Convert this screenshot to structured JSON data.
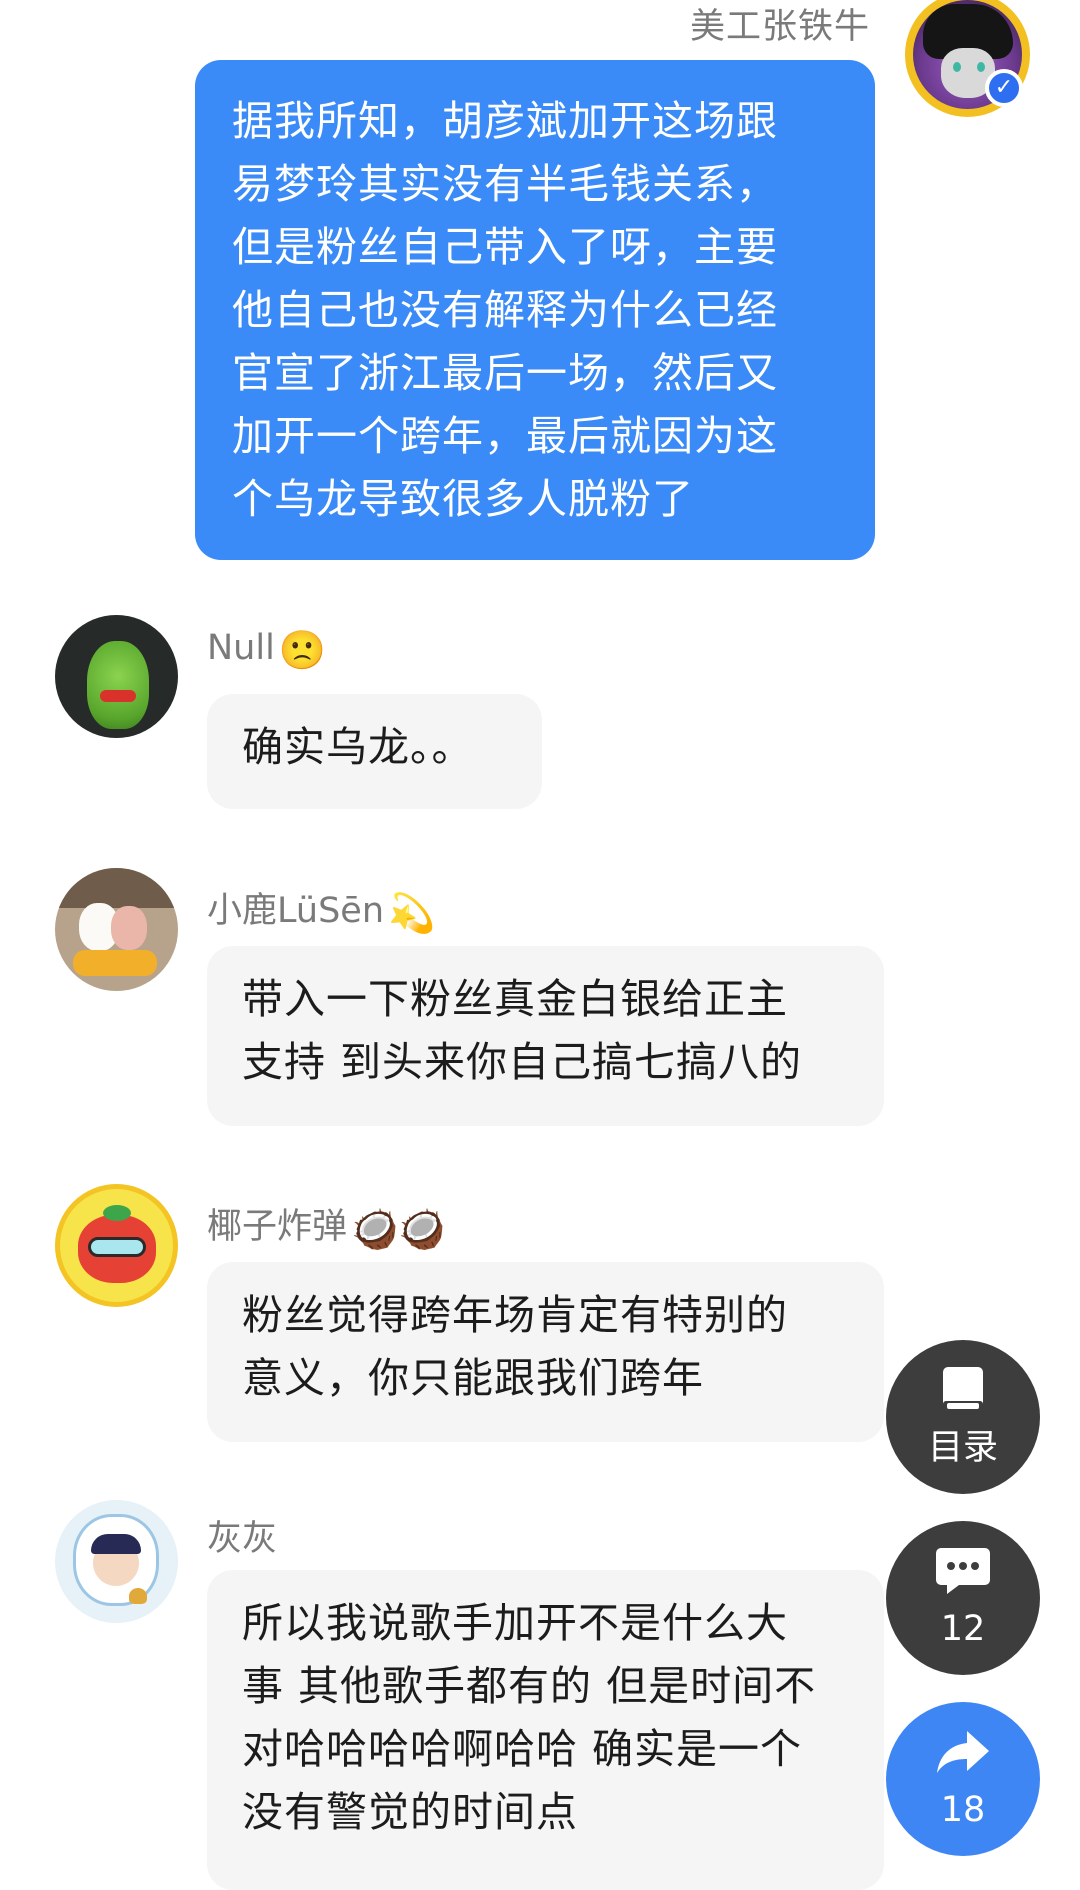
{
  "outgoing": {
    "sender": "美工张铁牛",
    "avatar_icon": "avatar-character-icon",
    "badge_icon": "verified-check-icon",
    "lines": [
      "据我所知，胡彦斌加开这场跟",
      "易梦玲其实没有半毛钱关系，",
      "但是粉丝自己带入了呀，主要",
      "他自己也没有解释为什么已经",
      "官宣了浙江最后一场，然后又",
      "加开一个跨年，最后就因为这",
      "个乌龙导致很多人脱粉了"
    ]
  },
  "messages": [
    {
      "sender": "Null",
      "emoji": "🙁",
      "lines": [
        "确实乌龙。。"
      ]
    },
    {
      "sender": "小鹿LüSēn",
      "emoji": "💫",
      "lines": [
        "带入一下粉丝真金白银给正主",
        "支持 到头来你自己搞七搞八的"
      ]
    },
    {
      "sender": "椰子炸弹",
      "emoji": "🥥🥥",
      "lines": [
        "粉丝觉得跨年场肯定有特别的",
        "意义，你只能跟我们跨年"
      ]
    },
    {
      "sender": "灰灰",
      "emoji": "",
      "lines": [
        "所以我说歌手加开不是什么大",
        "事 其他歌手都有的 但是时间不",
        "对哈哈哈哈啊哈哈 确实是一个",
        "没有警觉的时间点"
      ]
    }
  ],
  "float_buttons": {
    "toc": {
      "label": "目录",
      "icon": "book-icon"
    },
    "comments": {
      "label": "12",
      "icon": "comment-icon"
    },
    "share": {
      "label": "18",
      "icon": "share-arrow-icon"
    }
  },
  "colors": {
    "outgoing_bubble": "#3a8af7",
    "incoming_bubble": "#f5f5f5",
    "float_button": "#3d3d3d",
    "share_button": "#3f86f5"
  }
}
